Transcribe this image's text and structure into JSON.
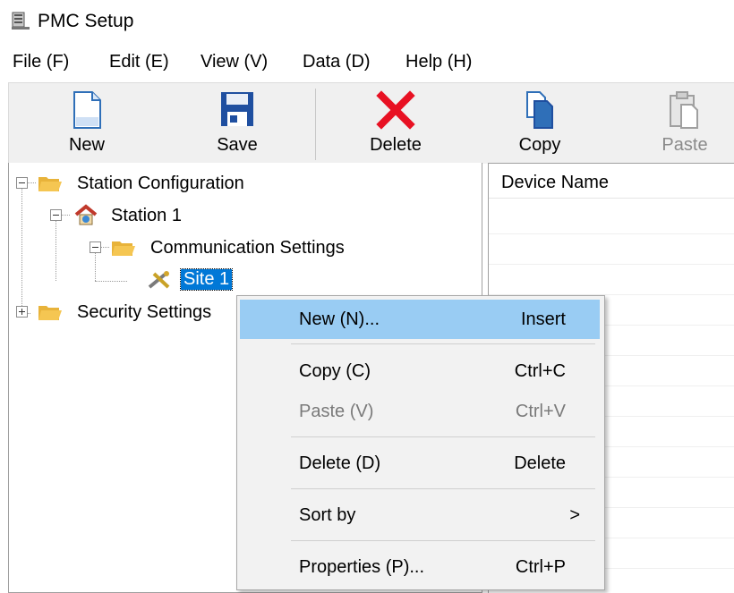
{
  "window": {
    "title": "PMC Setup"
  },
  "menu": [
    {
      "label": "File (F)"
    },
    {
      "label": "Edit (E)"
    },
    {
      "label": "View (V)"
    },
    {
      "label": "Data (D)"
    },
    {
      "label": "Help (H)"
    }
  ],
  "toolbar": {
    "new": "New",
    "save": "Save",
    "delete": "Delete",
    "copy": "Copy",
    "paste": "Paste"
  },
  "tree": {
    "station_configuration": "Station Configuration",
    "station1": "Station 1",
    "communication_settings": "Communication Settings",
    "site1": "Site 1",
    "security_settings": "Security Settings"
  },
  "list": {
    "column_device_name": "Device Name"
  },
  "context_menu": {
    "new": {
      "label": "New (N)...",
      "shortcut": "Insert"
    },
    "copy": {
      "label": "Copy (C)",
      "shortcut": "Ctrl+C"
    },
    "paste": {
      "label": "Paste (V)",
      "shortcut": "Ctrl+V"
    },
    "delete": {
      "label": "Delete (D)",
      "shortcut": "Delete"
    },
    "sort_by": {
      "label": "Sort by",
      "arrow": ">"
    },
    "properties": {
      "label": "Properties (P)...",
      "shortcut": "Ctrl+P"
    }
  },
  "colors": {
    "selection": "#0078d7",
    "menu_hover": "#99ccf3",
    "delete_icon": "#e81123",
    "folder": "#f5c652"
  }
}
